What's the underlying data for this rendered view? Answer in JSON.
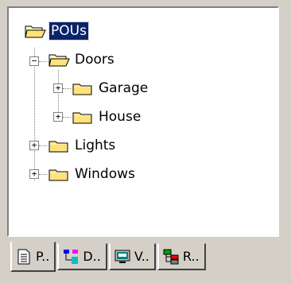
{
  "tree": {
    "root": {
      "label": "POUs",
      "icon": "open-folder-icon"
    },
    "items": [
      {
        "label": "Doors",
        "icon": "open-folder-icon",
        "expander": "−"
      },
      {
        "label": "Garage",
        "icon": "folder-icon",
        "expander": "+"
      },
      {
        "label": "House",
        "icon": "folder-icon",
        "expander": "+"
      },
      {
        "label": "Lights",
        "icon": "folder-icon",
        "expander": "+"
      },
      {
        "label": "Windows",
        "icon": "folder-icon",
        "expander": "+"
      }
    ]
  },
  "tabs": [
    {
      "label": "P..",
      "icon": "document-icon"
    },
    {
      "label": "D..",
      "icon": "datatype-icon"
    },
    {
      "label": "V..",
      "icon": "visualization-icon"
    },
    {
      "label": "R..",
      "icon": "resources-icon"
    }
  ],
  "colors": {
    "selection": "#0a246a",
    "folder": "#ffe27a",
    "window": "#d4d0c8"
  }
}
